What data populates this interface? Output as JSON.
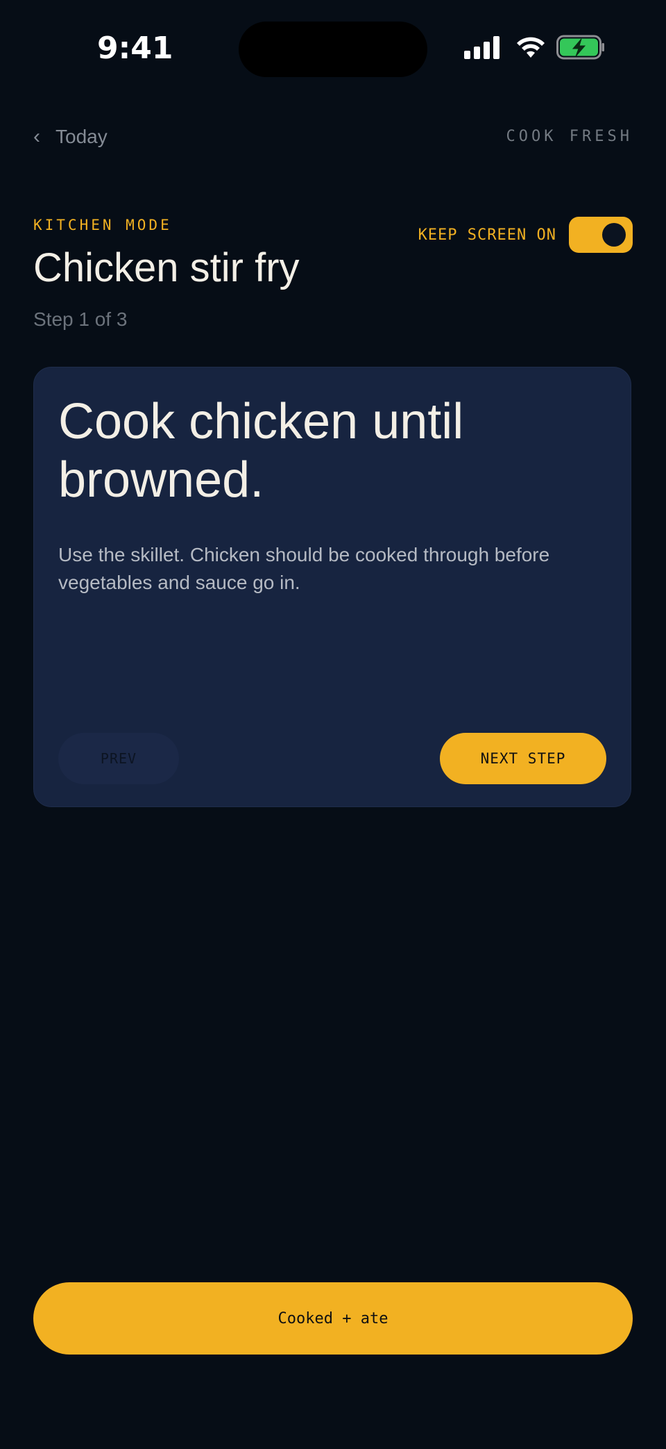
{
  "status_bar": {
    "time": "9:41",
    "icons": [
      "cellular-signal-icon",
      "wifi-icon",
      "battery-charging-icon"
    ],
    "battery_color": "#34c759"
  },
  "nav": {
    "back_label": "Today",
    "brand": "COOK FRESH"
  },
  "header": {
    "mode_label": "KITCHEN MODE",
    "title": "Chicken stir fry",
    "step_count": "Step 1 of 3",
    "keep_screen_label": "KEEP SCREEN ON",
    "keep_screen_on": true
  },
  "step_card": {
    "headline": "Cook chicken until browned.",
    "body": "Use the skillet. Chicken should be cooked through before vegetables and sauce go in.",
    "prev_label": "PREV",
    "next_label": "NEXT STEP"
  },
  "footer": {
    "done_label": "Cooked + ate"
  },
  "colors": {
    "background": "#060d16",
    "accent": "#f2b122",
    "card": "#172440"
  }
}
